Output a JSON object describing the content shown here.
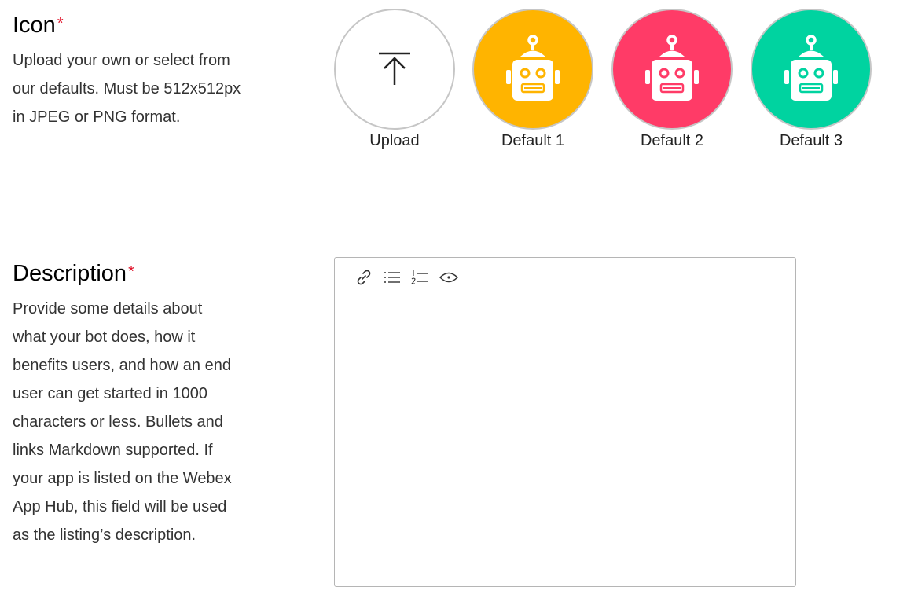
{
  "icon_section": {
    "title": "Icon",
    "required_mark": "*",
    "description": "Upload your own or select from our defaults. Must be 512x512px in JPEG or PNG format.",
    "options": [
      {
        "label": "Upload",
        "icon": "upload-arrow-icon",
        "color": "#ffffff"
      },
      {
        "label": "Default 1",
        "icon": "robot-icon",
        "color": "#ffb400"
      },
      {
        "label": "Default 2",
        "icon": "robot-icon",
        "color": "#ff3b67"
      },
      {
        "label": "Default 3",
        "icon": "robot-icon",
        "color": "#00d3a0"
      }
    ]
  },
  "description_section": {
    "title": "Description",
    "required_mark": "*",
    "description": "Provide some details about what your bot does, how it benefits users, and how an end user can get started in 1000 characters or less. Bullets and links Markdown supported. If your app is listed on the Webex App Hub, this field will be used as the listing’s description.",
    "toolbar": [
      "link-icon",
      "bulleted-list-icon",
      "numbered-list-icon",
      "preview-eye-icon"
    ],
    "value": "",
    "placeholder": ""
  },
  "colors": {
    "required": "#e0132a",
    "default_1": "#ffb400",
    "default_2": "#ff3b67",
    "default_3": "#00d3a0"
  }
}
